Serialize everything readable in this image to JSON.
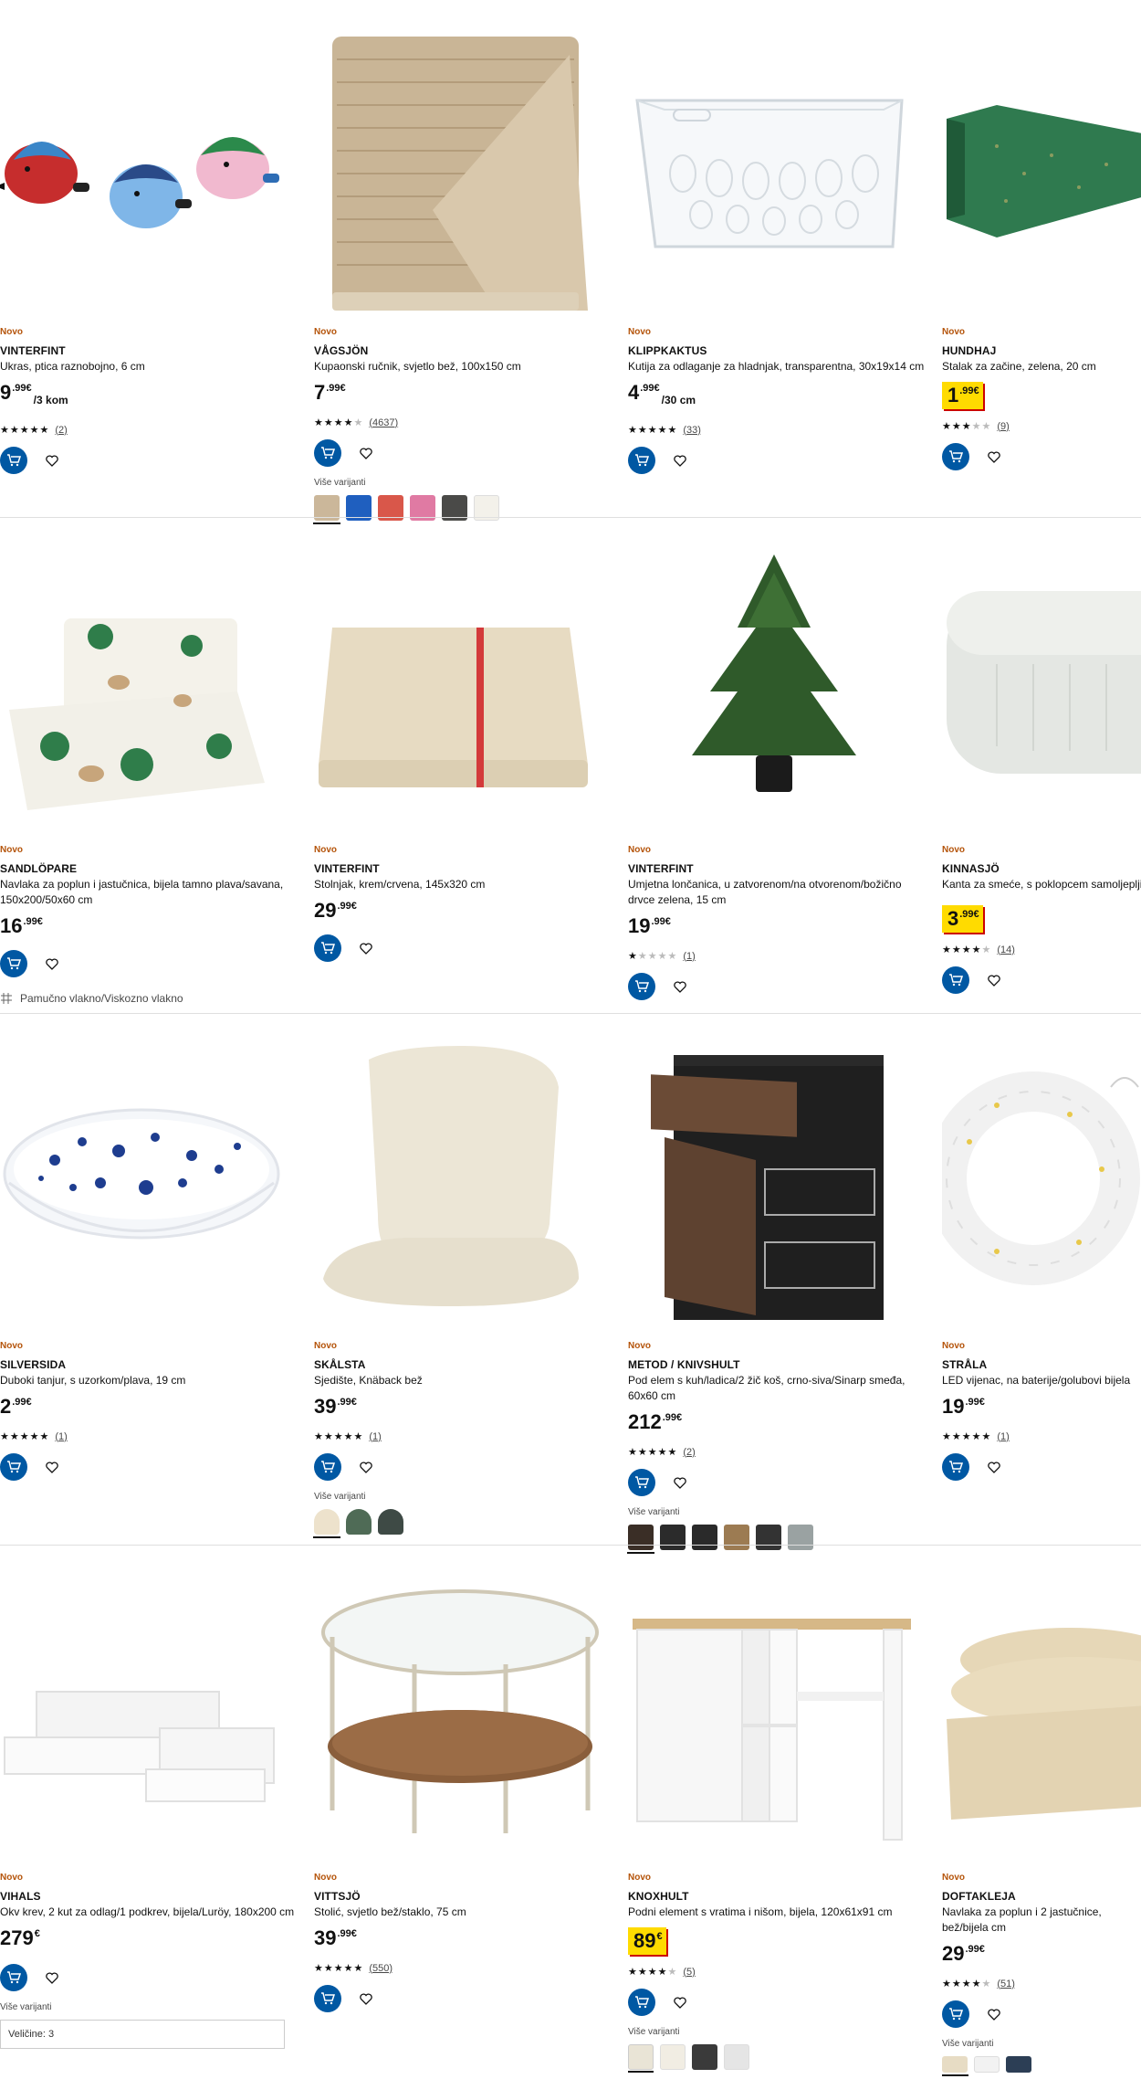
{
  "badge_new": "Novo",
  "more_variants": "Više varijanti",
  "rows": [
    {
      "products": [
        {
          "name": "VINTERFINT",
          "desc": "Ukras, ptica raznobojno, 6 cm",
          "price_int": "9",
          "price_dec": ".99€",
          "unit": "/3 kom",
          "rating_count": "(2)",
          "stars": 5
        },
        {
          "name": "VÅGSJÖN",
          "desc": "Kupaonski ručnik, svjetlo bež, 100x150 cm",
          "price_int": "7",
          "price_dec": ".99€",
          "unit": "",
          "rating_count": "(4637)",
          "stars": 4.5
        },
        {
          "name": "KLIPPKAKTUS",
          "desc": "Kutija za odlaganje za hladnjak, transparentna, 30x19x14 cm",
          "price_int": "4",
          "price_dec": ".99€",
          "unit": "/30 cm",
          "rating_count": "(33)",
          "stars": 4.5
        },
        {
          "name": "HUNDHAJ",
          "desc": "Stalak za začine, zelena, 20 cm",
          "price_int": "1",
          "price_dec": ".99€",
          "unit": "",
          "rating_count": "(9)",
          "stars": 3.5,
          "highlight": true
        }
      ]
    },
    {
      "products": [
        {
          "name": "SANDLÖPARE",
          "desc": "Navlaka za poplun i jastučnica, bijela tamno plava/savana, 150x200/50x60 cm",
          "price_int": "16",
          "price_dec": ".99€",
          "unit": "",
          "material": "Pamučno vlakno/Viskozno vlakno"
        },
        {
          "name": "VINTERFINT",
          "desc": "Stolnjak, krem/crvena, 145x320 cm",
          "price_int": "29",
          "price_dec": ".99€",
          "unit": ""
        },
        {
          "name": "VINTERFINT",
          "desc": "Umjetna lončanica, u zatvorenom/na otvorenom/božično drvce zelena, 15 cm",
          "price_int": "19",
          "price_dec": ".99€",
          "unit": "",
          "rating_count": "(1)",
          "stars": 1
        },
        {
          "name": "KINNASJÖ",
          "desc": "Kanta za smeće, s poklopcem samoljepljiv",
          "price_int": "3",
          "price_dec": ".99€",
          "unit": "",
          "rating_count": "(14)",
          "stars": 4.5,
          "highlight": true
        }
      ]
    },
    {
      "products": [
        {
          "name": "SILVERSIDA",
          "desc": "Duboki tanjur, s uzorkom/plava, 19 cm",
          "price_int": "2",
          "price_dec": ".99€",
          "unit": "",
          "rating_count": "(1)",
          "stars": 5
        },
        {
          "name": "SKÅLSTA",
          "desc": "Sjedište, Knäback bež",
          "price_int": "39",
          "price_dec": ".99€",
          "unit": "",
          "rating_count": "(1)",
          "stars": 5
        },
        {
          "name": "METOD / KNIVSHULT",
          "desc": "Pod elem s kuh/ladica/2 žič koš, crno-siva/Sinarp smeđa, 60x60 cm",
          "price_int": "212",
          "price_dec": ".99€",
          "unit": "",
          "rating_count": "(2)",
          "stars": 5
        },
        {
          "name": "STRÅLA",
          "desc": "LED vijenac, na baterije/golubovi bijela",
          "price_int": "19",
          "price_dec": ".99€",
          "unit": "",
          "rating_count": "(1)",
          "stars": 5
        }
      ]
    },
    {
      "products": [
        {
          "name": "VIHALS",
          "desc": "Okv krev, 2 kut za odlag/1 podkrev, bijela/Luröy, 180x200 cm",
          "price_int": "279",
          "price_dec": "€",
          "unit": "",
          "size_label": "Veličine: 3"
        },
        {
          "name": "VITTSJÖ",
          "desc": "Stolić, svjetlo bež/staklo, 75 cm",
          "price_int": "39",
          "price_dec": ".99€",
          "unit": "",
          "rating_count": "(550)",
          "stars": 5
        },
        {
          "name": "KNOXHULT",
          "desc": "Podni element s vratima i nišom, bijela, 120x61x91 cm",
          "price_int": "89",
          "price_dec": "€",
          "unit": "",
          "rating_count": "(5)",
          "stars": 4.5,
          "highlight": true
        },
        {
          "name": "DOFTAKLEJA",
          "desc": "Navlaka za poplun i 2 jastučnice, bež/bijela cm",
          "price_int": "29",
          "price_dec": ".99€",
          "unit": "",
          "rating_count": "(51)",
          "stars": 4.5
        }
      ]
    }
  ],
  "swatch_colors": {
    "vagsjon": [
      "#cbb79a",
      "#1f5fbf",
      "#d9574a",
      "#e07aa3",
      "#4a4a48",
      "#f3f1ea"
    ],
    "skalsta": [
      "#ede2cc",
      "#4f6b56",
      "#3e4a45"
    ],
    "metod": [
      "#3a2e26",
      "#2b2b2b",
      "#2a2a2a",
      "#9c7b52",
      "#333333",
      "#9aa2a2"
    ],
    "knoxhult": [
      "#e9e4d6",
      "#f1ede3",
      "#3a3a3a",
      "#e5e5e5"
    ],
    "doftakleja": [
      "#e7dcc4",
      "#f2f2f2",
      "#2c3e55"
    ]
  },
  "accent_color": "#0058a3",
  "new_color": "#b45309",
  "icons": [
    "add-to-cart-icon",
    "heart-icon",
    "material-icon"
  ]
}
